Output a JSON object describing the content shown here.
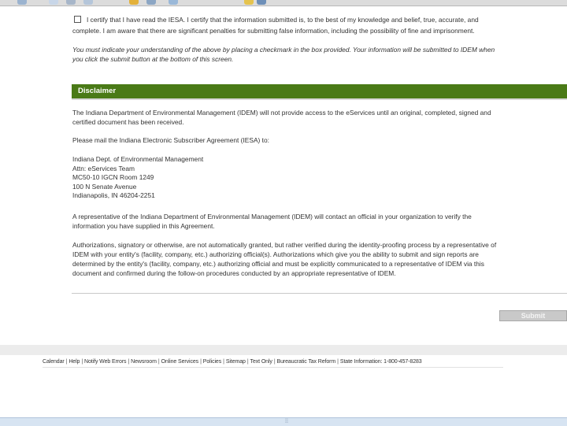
{
  "certification": {
    "line1": "I certify that I have read the IESA. I certify that the information submitted is, to the best of my knowledge and belief, true, accurate, and",
    "line2": "complete. I am aware that there are significant penalties for submitting false information, including the possibility of fine and imprisonment.",
    "notice_line1": "You must indicate your understanding of the above by placing a checkmark in the box provided. Your information will be submitted to IDEM when",
    "notice_line2": "you click the submit button at the bottom of this screen."
  },
  "disclaimer": {
    "title": "Disclaimer",
    "p1_line1": "The Indiana Department of Environmental Management (IDEM) will not provide access to the eServices until an original, completed, signed and",
    "p1_line2": "certified document has been received.",
    "p2": "Please mail the Indiana Electronic Subscriber Agreement (IESA) to:",
    "address": [
      "Indiana Dept. of Environmental Management",
      "Attn: eServices Team",
      "MC50-10 IGCN Room 1249",
      "100 N Senate Avenue",
      "Indianapolis, IN 46204-2251"
    ],
    "p3_line1": "A representative of the Indiana Department of Environmental Management (IDEM) will contact an official in your organization to verify the",
    "p3_line2": "information you have supplied in this Agreement.",
    "p4_line1": "Authorizations, signatory or otherwise, are not automatically granted, but rather verified during the identity-proofing process by a representative of",
    "p4_line2": "IDEM with your entity's (facility, company, etc.) authorizing official(s). Authorizations which give you the ability to submit and sign reports are",
    "p4_line3": "determined by the entity's (facility, company, etc.) authorizing official and must be explicitly communicated to a representative of IDEM via this",
    "p4_line4": "document and confirmed during the follow-on procedures conducted by an appropriate representative of IDEM."
  },
  "submit_label": "Submit",
  "footer": {
    "links": [
      "Calendar",
      "Help",
      "Notify Web Errors",
      "Newsroom",
      "Online Services",
      "Policies",
      "Sitemap",
      "Text Only",
      "Bureaucratic Tax Reform"
    ],
    "state_info": "State Information: 1-800-457-8283"
  },
  "colors": {
    "disclaimer_bar": "#4a7a17",
    "status_bar": "#d7e4f2"
  }
}
